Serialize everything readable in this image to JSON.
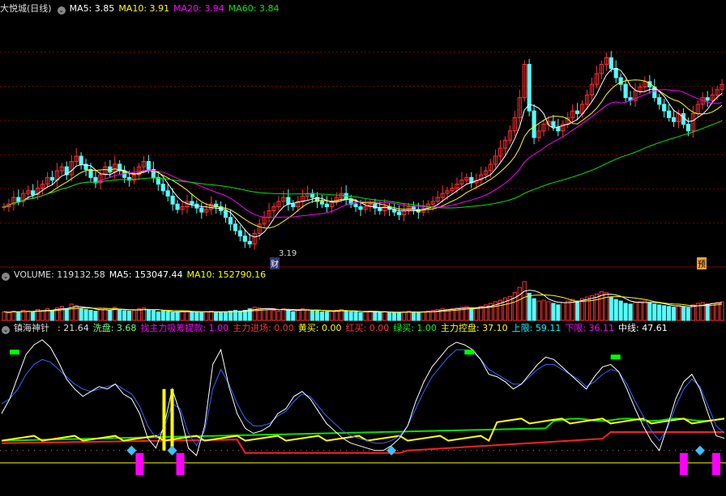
{
  "price_header": {
    "title": "大悦城(日线)",
    "ma5": "MA5: 3.85",
    "ma10": "MA10: 3.91",
    "ma20": "MA20: 3.94",
    "ma60": "MA60: 3.84",
    "low_label": "3.19",
    "tag_cai": "财",
    "tag_yu": "预"
  },
  "volume_header": {
    "volume": "VOLUME: 119132.58",
    "ma5": "MA5: 153047.44",
    "ma10": "MA10: 152790.16"
  },
  "indicator_header": {
    "name": "镇海神针",
    "val": ": 21.64",
    "xipan": "洗盘: 3.68",
    "zhaozhuli": "找主力吸筹提款: 1.00",
    "jinchang": "主力进场: 0.00",
    "huangmai": "黄买: 0.00",
    "hongmai": "红买: 0.00",
    "lvmai": "绿买: 1.00",
    "kongpan": "主力控盘: 37.10",
    "shangxian": "上限: 59.11",
    "xiaxian": "下限: 36.11",
    "zhongxian": "中线: 47.61"
  },
  "colors": {
    "up": "#ff3232",
    "down": "#54ffff",
    "ma5": "#ffffff",
    "ma10": "#ffff00",
    "ma20": "#ff00ff",
    "ma60": "#00e600",
    "grid": "#800000",
    "accent_magenta": "#ff00ff"
  },
  "chart_data": [
    {
      "type": "candlestick",
      "title": "大悦城(日线)",
      "y_low_marked": 3.19,
      "ylim": [
        3.1,
        4.9
      ],
      "series": [
        {
          "name": "MA5",
          "value": 3.85
        },
        {
          "name": "MA10",
          "value": 3.91
        },
        {
          "name": "MA20",
          "value": 3.94
        },
        {
          "name": "MA60",
          "value": 3.84
        }
      ],
      "close": [
        3.48,
        3.5,
        3.55,
        3.52,
        3.58,
        3.6,
        3.57,
        3.62,
        3.65,
        3.7,
        3.68,
        3.75,
        3.78,
        3.72,
        3.82,
        3.86,
        3.8,
        3.76,
        3.7,
        3.66,
        3.72,
        3.78,
        3.74,
        3.8,
        3.75,
        3.7,
        3.68,
        3.72,
        3.78,
        3.82,
        3.76,
        3.7,
        3.65,
        3.6,
        3.56,
        3.5,
        3.46,
        3.48,
        3.52,
        3.5,
        3.47,
        3.44,
        3.46,
        3.5,
        3.48,
        3.45,
        3.4,
        3.35,
        3.3,
        3.26,
        3.22,
        3.2,
        3.28,
        3.35,
        3.4,
        3.45,
        3.48,
        3.52,
        3.55,
        3.5,
        3.48,
        3.52,
        3.56,
        3.58,
        3.55,
        3.52,
        3.5,
        3.48,
        3.52,
        3.55,
        3.58,
        3.54,
        3.5,
        3.48,
        3.46,
        3.48,
        3.5,
        3.47,
        3.45,
        3.48,
        3.46,
        3.44,
        3.42,
        3.45,
        3.48,
        3.46,
        3.44,
        3.47,
        3.5,
        3.52,
        3.55,
        3.58,
        3.6,
        3.62,
        3.65,
        3.68,
        3.7,
        3.66,
        3.68,
        3.72,
        3.75,
        3.8,
        3.86,
        3.92,
        3.98,
        4.05,
        4.15,
        4.3,
        4.55,
        4.2,
        4.0,
        4.05,
        4.1,
        4.12,
        4.08,
        4.05,
        4.1,
        4.15,
        4.2,
        4.18,
        4.25,
        4.32,
        4.4,
        4.48,
        4.55,
        4.6,
        4.52,
        4.45,
        4.4,
        4.3,
        4.28,
        4.35,
        4.38,
        4.42,
        4.38,
        4.3,
        4.25,
        4.2,
        4.15,
        4.12,
        4.18,
        4.1,
        4.05,
        4.18,
        4.25,
        4.3,
        4.28,
        4.32,
        4.36,
        4.4
      ],
      "volume_ma5": 153047.44,
      "volume_ma10": 152790.16,
      "volume_last": 119132.58,
      "volume": [
        0.22,
        0.2,
        0.24,
        0.22,
        0.26,
        0.24,
        0.22,
        0.28,
        0.25,
        0.3,
        0.26,
        0.32,
        0.36,
        0.3,
        0.42,
        0.38,
        0.3,
        0.28,
        0.26,
        0.24,
        0.28,
        0.3,
        0.26,
        0.34,
        0.28,
        0.25,
        0.24,
        0.26,
        0.3,
        0.32,
        0.28,
        0.25,
        0.22,
        0.24,
        0.22,
        0.2,
        0.22,
        0.24,
        0.25,
        0.22,
        0.21,
        0.2,
        0.22,
        0.24,
        0.22,
        0.2,
        0.22,
        0.24,
        0.26,
        0.24,
        0.26,
        0.3,
        0.34,
        0.32,
        0.3,
        0.28,
        0.26,
        0.24,
        0.3,
        0.26,
        0.22,
        0.26,
        0.3,
        0.28,
        0.26,
        0.24,
        0.22,
        0.22,
        0.24,
        0.26,
        0.28,
        0.24,
        0.22,
        0.22,
        0.2,
        0.22,
        0.24,
        0.22,
        0.2,
        0.22,
        0.21,
        0.2,
        0.2,
        0.22,
        0.24,
        0.22,
        0.2,
        0.22,
        0.24,
        0.26,
        0.28,
        0.3,
        0.28,
        0.3,
        0.32,
        0.34,
        0.36,
        0.3,
        0.32,
        0.36,
        0.4,
        0.44,
        0.48,
        0.52,
        0.58,
        0.62,
        0.72,
        0.85,
        1.0,
        0.7,
        0.56,
        0.5,
        0.52,
        0.48,
        0.44,
        0.4,
        0.46,
        0.5,
        0.54,
        0.5,
        0.56,
        0.6,
        0.64,
        0.68,
        0.74,
        0.72,
        0.6,
        0.54,
        0.5,
        0.44,
        0.42,
        0.46,
        0.48,
        0.5,
        0.46,
        0.42,
        0.4,
        0.38,
        0.36,
        0.34,
        0.38,
        0.34,
        0.32,
        0.4,
        0.44,
        0.46,
        0.42,
        0.44,
        0.46,
        0.48
      ]
    },
    {
      "type": "line",
      "title": "镇海神针",
      "ylim": [
        0,
        100
      ],
      "series": [
        {
          "name": "上限",
          "value": 59.11
        },
        {
          "name": "下限",
          "value": 36.11
        },
        {
          "name": "中线",
          "value": 47.61
        },
        {
          "name": "主力控盘",
          "value": 37.1
        },
        {
          "name": "洗盘",
          "value": 3.68
        }
      ],
      "kd": [
        40,
        52,
        70,
        88,
        96,
        100,
        94,
        82,
        68,
        60,
        54,
        58,
        62,
        60,
        64,
        56,
        52,
        40,
        20,
        12,
        30,
        60,
        40,
        12,
        6,
        30,
        80,
        92,
        62,
        40,
        28,
        24,
        26,
        30,
        40,
        44,
        54,
        58,
        52,
        42,
        32,
        26,
        20,
        16,
        14,
        12,
        10,
        10,
        14,
        20,
        30,
        50,
        66,
        78,
        86,
        94,
        98,
        96,
        92,
        84,
        72,
        70,
        66,
        60,
        64,
        72,
        80,
        86,
        84,
        78,
        72,
        66,
        60,
        70,
        78,
        80,
        74,
        60,
        44,
        30,
        18,
        10,
        30,
        52,
        66,
        72,
        60,
        40,
        22,
        20
      ],
      "kd2": [
        48,
        52,
        60,
        72,
        80,
        84,
        82,
        76,
        70,
        64,
        60,
        58,
        60,
        62,
        64,
        60,
        56,
        46,
        30,
        20,
        28,
        48,
        44,
        24,
        14,
        26,
        60,
        76,
        64,
        48,
        36,
        30,
        30,
        32,
        38,
        42,
        50,
        56,
        54,
        46,
        38,
        32,
        26,
        22,
        20,
        18,
        16,
        16,
        18,
        22,
        30,
        44,
        58,
        70,
        78,
        86,
        92,
        92,
        90,
        84,
        76,
        72,
        68,
        64,
        64,
        70,
        76,
        80,
        80,
        76,
        72,
        68,
        62,
        66,
        72,
        76,
        74,
        64,
        50,
        38,
        26,
        18,
        28,
        46,
        60,
        68,
        62,
        46,
        30,
        24
      ]
    }
  ]
}
